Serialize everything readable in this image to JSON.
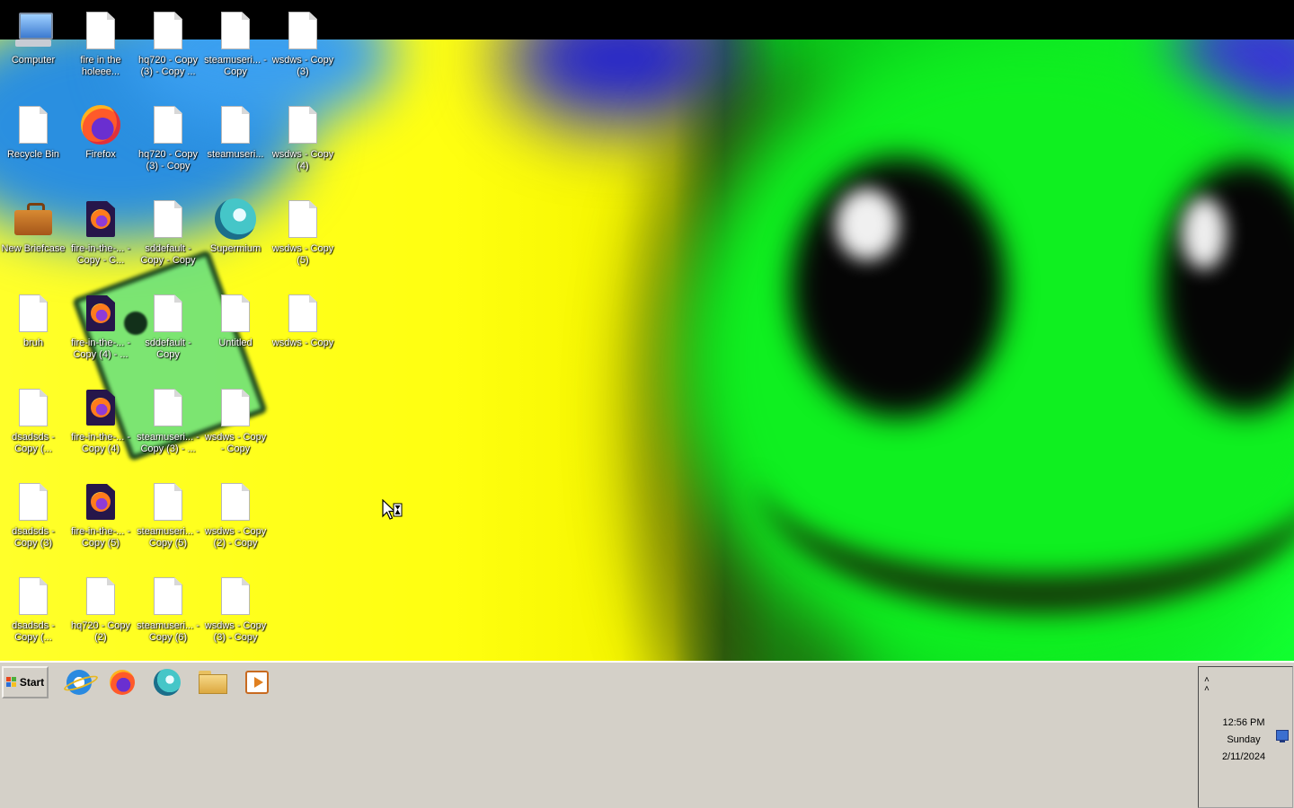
{
  "desktop": {
    "icons": [
      {
        "label": "Computer",
        "icon": "computer-icon"
      },
      {
        "label": "fire in the holeee...",
        "icon": "document-icon"
      },
      {
        "label": "hq720 - Copy (3) - Copy ...",
        "icon": "document-icon"
      },
      {
        "label": "steamuseri... - Copy",
        "icon": "document-icon"
      },
      {
        "label": "wsdws - Copy (3)",
        "icon": "document-icon"
      },
      {
        "label": "Recycle Bin",
        "icon": "recycle-bin-icon"
      },
      {
        "label": "Firefox",
        "icon": "firefox-icon"
      },
      {
        "label": "hq720 - Copy (3) - Copy",
        "icon": "document-icon"
      },
      {
        "label": "steamuseri...",
        "icon": "document-icon"
      },
      {
        "label": "wsdws - Copy (4)",
        "icon": "document-icon"
      },
      {
        "label": "New Briefcase",
        "icon": "briefcase-icon"
      },
      {
        "label": "fire-in-the-... - Copy - C...",
        "icon": "firefox-document-icon"
      },
      {
        "label": "sddefault - Copy - Copy",
        "icon": "document-icon"
      },
      {
        "label": "Supermium",
        "icon": "supermium-icon"
      },
      {
        "label": "wsdws - Copy (5)",
        "icon": "document-icon"
      },
      {
        "label": "bruh",
        "icon": "document-icon"
      },
      {
        "label": "fire-in-the-... - Copy (4) - ...",
        "icon": "firefox-document-icon"
      },
      {
        "label": "sddefault - Copy",
        "icon": "document-icon"
      },
      {
        "label": "Untitled",
        "icon": "document-icon"
      },
      {
        "label": "wsdws - Copy",
        "icon": "document-icon"
      },
      {
        "label": "dsadsds - Copy (...",
        "icon": "document-icon"
      },
      {
        "label": "fire-in-the-... - Copy (4)",
        "icon": "firefox-document-icon"
      },
      {
        "label": "steamuseri... - Copy (3) - ...",
        "icon": "document-icon"
      },
      {
        "label": "wsdws - Copy - Copy",
        "icon": "document-icon"
      },
      {
        "label": "dsadsds - Copy (3)",
        "icon": "document-icon"
      },
      {
        "label": "fire-in-the-... - Copy (5)",
        "icon": "firefox-document-icon"
      },
      {
        "label": "steamuseri... - Copy (5)",
        "icon": "document-icon"
      },
      {
        "label": "wsdws - Copy (2) - Copy",
        "icon": "document-icon"
      },
      {
        "label": "dsadsds - Copy (...",
        "icon": "document-icon"
      },
      {
        "label": "hq720 - Copy (2)",
        "icon": "document-icon"
      },
      {
        "label": "steamuseri... - Copy (6)",
        "icon": "document-icon"
      },
      {
        "label": "wsdws - Copy (3) - Copy",
        "icon": "document-icon"
      }
    ]
  },
  "taskbar": {
    "start_label": "Start",
    "quick_launch": [
      {
        "icon": "internet-explorer-icon"
      },
      {
        "icon": "firefox-icon"
      },
      {
        "icon": "supermium-icon"
      },
      {
        "icon": "file-explorer-icon"
      },
      {
        "icon": "media-player-icon"
      }
    ],
    "tray": {
      "toggle_glyph": "˄\n˄",
      "time": "12:56 PM",
      "day": "Sunday",
      "date": "2/11/2024"
    }
  },
  "colors": {
    "taskbar": "#d4d0c8",
    "wallpaper_yellow": "#ffff10",
    "wallpaper_green": "#12ff30"
  }
}
